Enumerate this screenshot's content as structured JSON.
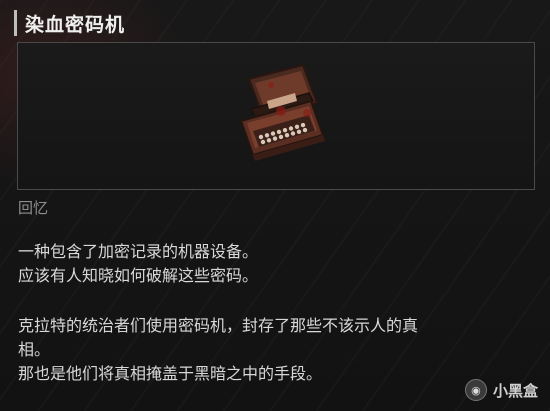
{
  "item": {
    "title": "染血密码机",
    "category": "回忆",
    "image_icon": "typewriter-icon"
  },
  "description": {
    "paragraph1": [
      "一种包含了加密记录的机器设备。",
      "应该有人知晓如何破解这些密码。"
    ],
    "paragraph2": [
      "克拉特的统治者们使用密码机，封存了那些不该示人的真",
      "相。",
      "那也是他们将真相掩盖于黑暗之中的手段。"
    ]
  },
  "watermark": {
    "logo_icon": "xiaoheihe-logo-icon",
    "text": "小黑盒"
  },
  "colors": {
    "background": "#141414",
    "title": "#f0f0f0",
    "text": "#d8d8d8",
    "category": "#8e8e8e",
    "frame_border": "#4a4a4a",
    "rust": "#6e3b2a"
  }
}
